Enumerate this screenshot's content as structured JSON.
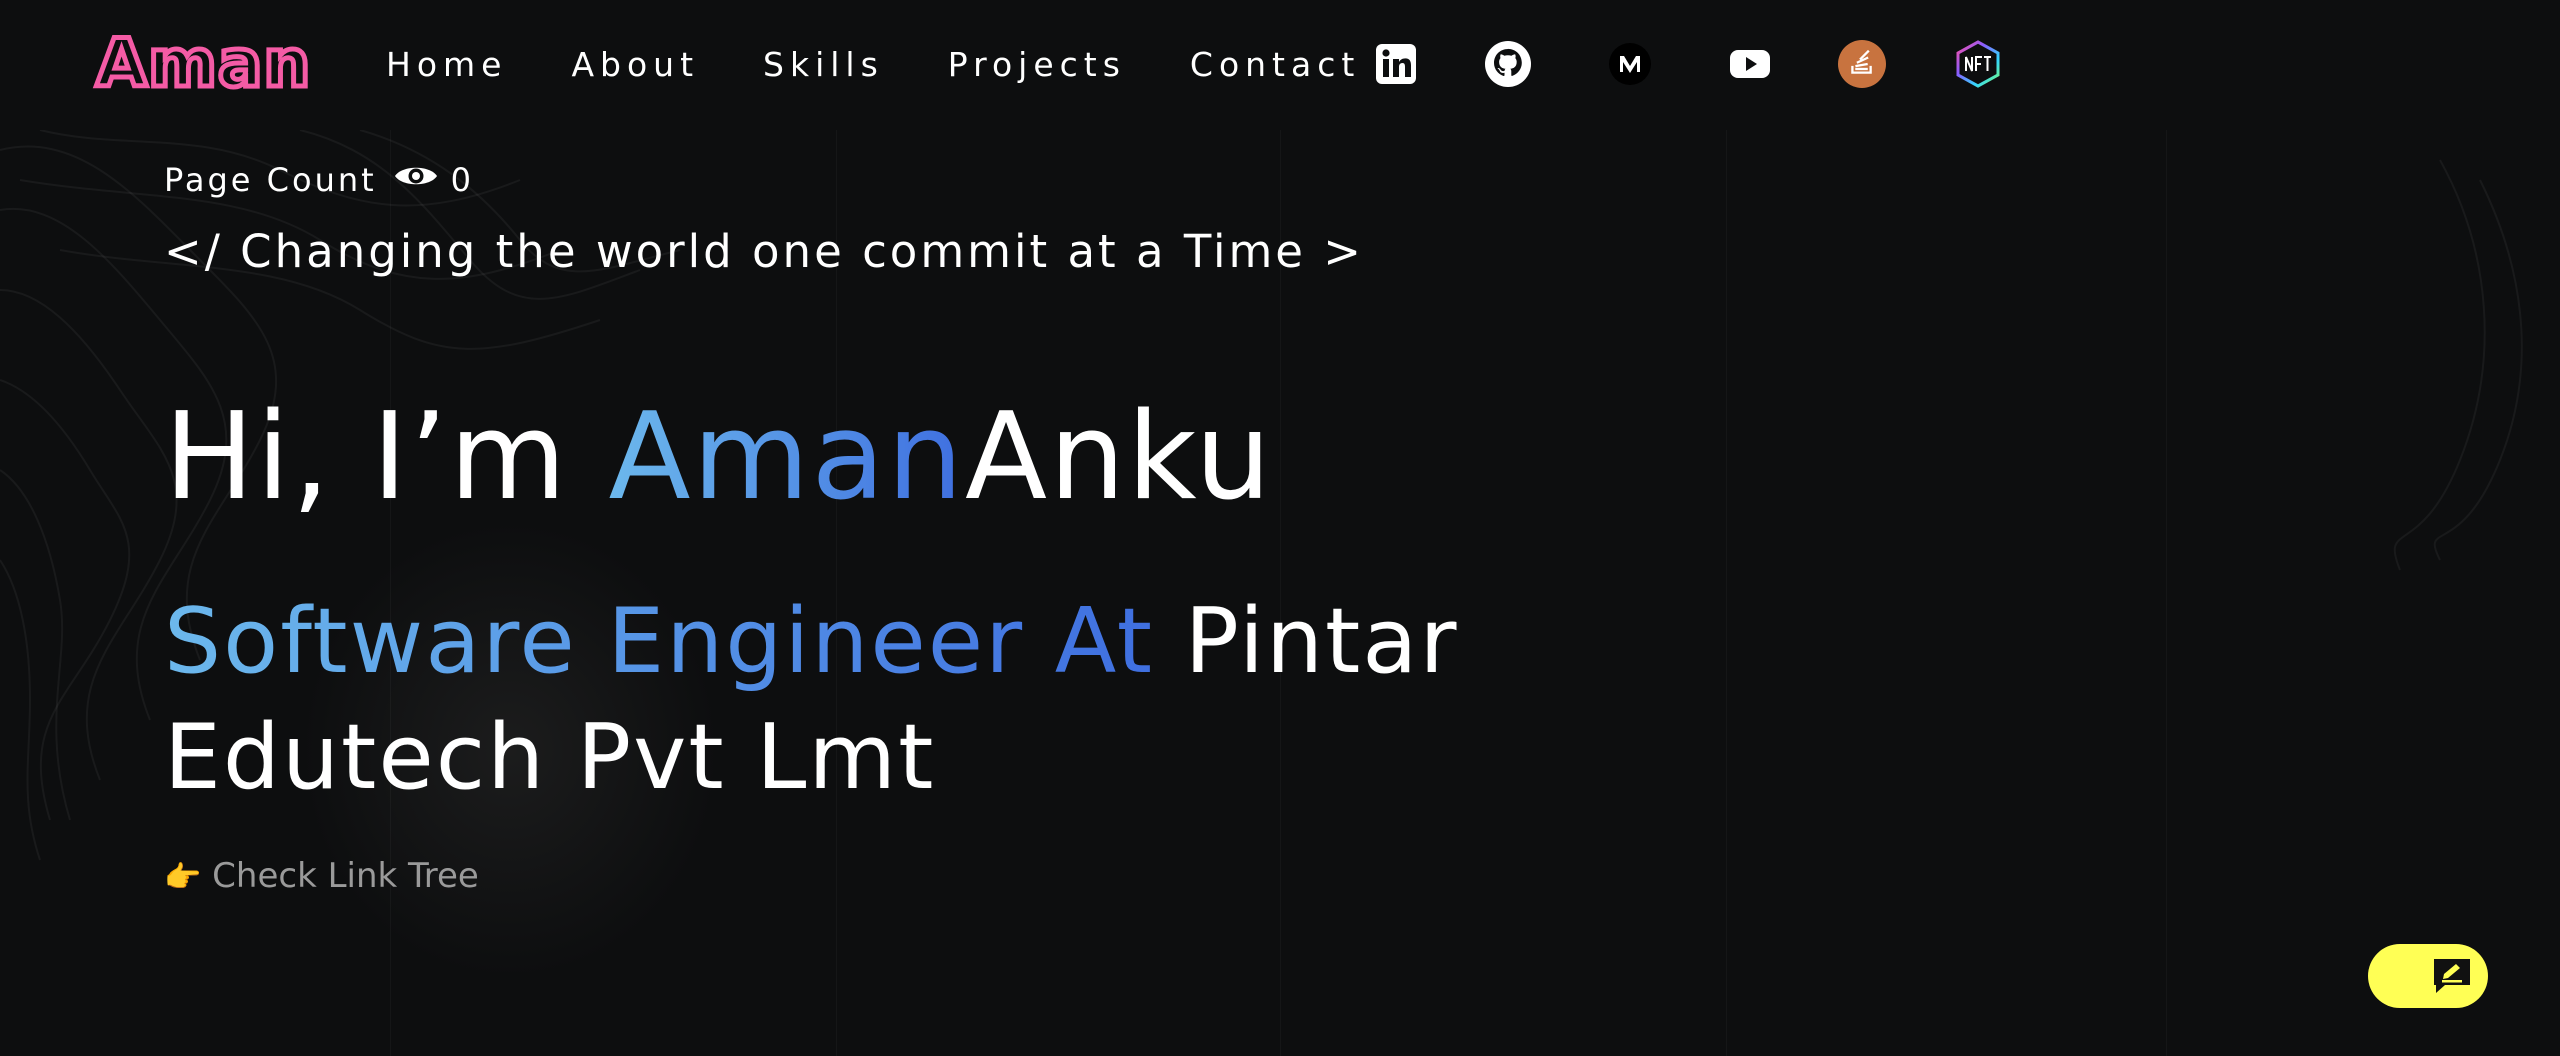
{
  "logo": {
    "text": "Aman"
  },
  "nav": {
    "links": [
      "Home",
      "About",
      "Skills",
      "Projects",
      "Contact"
    ],
    "social_icons": [
      "linkedin-icon",
      "github-icon",
      "medium-icon",
      "youtube-icon",
      "stackoverflow-icon",
      "nft-icon"
    ]
  },
  "hero": {
    "page_count_label": "Page Count",
    "page_count_value": "0",
    "tagline": "</ Changing the world one commit at a Time >",
    "greeting_prefix": "Hi, I’m ",
    "name_highlight": "Aman",
    "name_rest": "Anku",
    "role_highlight": "Software Engineer At",
    "role_rest": " Pintar Edutech Pvt Lmt",
    "linktree_emoji": "👉",
    "linktree_label": "Check Link Tree"
  },
  "colors": {
    "background": "#0d0e0f",
    "logo_pink": "#f45ba5",
    "gradient_start": "#6cb8ec",
    "gradient_end": "#3f6fe0",
    "feedback_yellow": "#ffff55",
    "stackoverflow_orange": "#c8733f"
  },
  "feedback_button": {
    "icon": "feedback-icon"
  }
}
